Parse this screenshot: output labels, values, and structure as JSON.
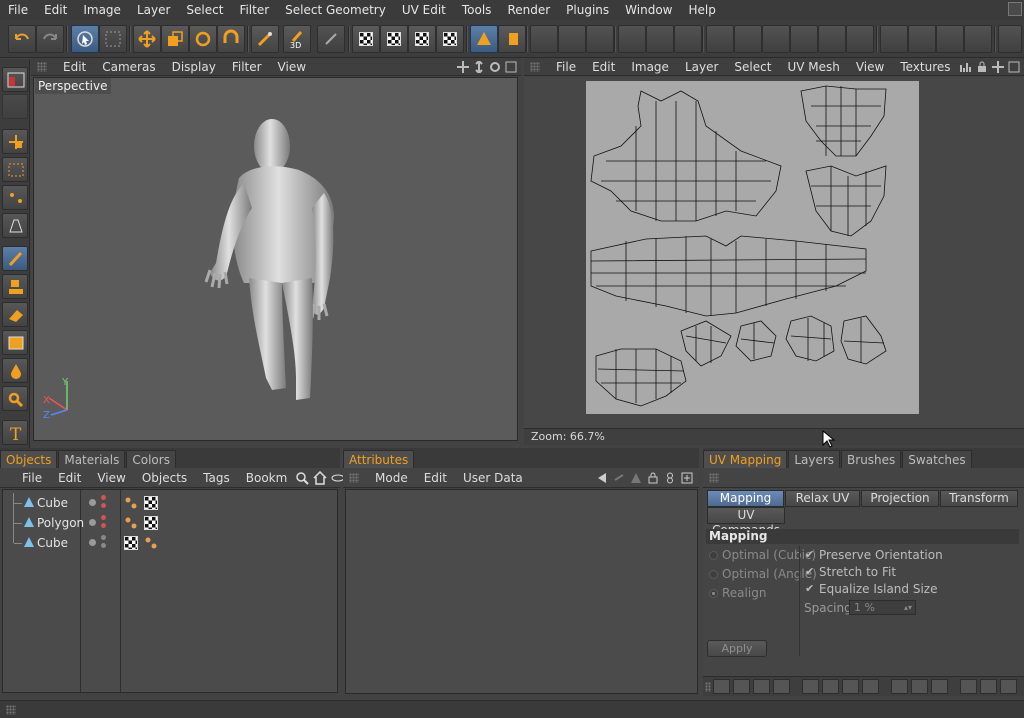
{
  "menubar": {
    "items": [
      "File",
      "Edit",
      "Image",
      "Layer",
      "Select",
      "Filter",
      "Select Geometry",
      "UV Edit",
      "Tools",
      "Render",
      "Plugins",
      "Window",
      "Help"
    ]
  },
  "toolbar": {
    "icons": [
      "undo-icon",
      "redo-icon",
      "live-selection-icon",
      "selection-lock-icon",
      "move-icon",
      "scale-icon",
      "rotate-icon",
      "magnet-icon",
      "paint-brush-icon",
      "3d-paint-icon",
      "texture-icon"
    ]
  },
  "viewport": {
    "menu": [
      "Edit",
      "Cameras",
      "Display",
      "Filter",
      "View"
    ],
    "label": "Perspective",
    "axes": {
      "x": "X",
      "y": "Y",
      "z": "Z"
    }
  },
  "uv_editor": {
    "menu": [
      "File",
      "Edit",
      "Image",
      "Layer",
      "Select",
      "UV Mesh",
      "View",
      "Textures"
    ],
    "status": "Zoom: 66.7%"
  },
  "objects_panel": {
    "tabs": [
      "Objects",
      "Materials",
      "Colors"
    ],
    "menu": [
      "File",
      "Edit",
      "View",
      "Objects",
      "Tags",
      "Bookm"
    ],
    "rows": [
      {
        "name": "Cube"
      },
      {
        "name": "Polygon"
      },
      {
        "name": "Cube"
      }
    ]
  },
  "attributes_panel": {
    "tabs": [
      "Attributes"
    ],
    "menu": [
      "Mode",
      "Edit",
      "User Data"
    ]
  },
  "uv_mapping_panel": {
    "tabs": [
      "UV Mapping",
      "Layers",
      "Brushes",
      "Swatches"
    ],
    "subtabs": [
      "Mapping",
      "Relax UV",
      "Projection",
      "Transform",
      "UV Commands"
    ],
    "section_title": "Mapping",
    "radio_options": [
      "Optimal (Cubic)",
      "Optimal (Angle)",
      "Realign"
    ],
    "checkboxes": [
      "Preserve Orientation",
      "Stretch to Fit",
      "Equalize Island Size"
    ],
    "spacing_label": "Spacing",
    "spacing_value": "1 %",
    "apply_label": "Apply"
  },
  "colors": {
    "active_tab": "#f0a020",
    "accent_blue": "#5c7fa8",
    "uv_canvas": "#a9a9a9"
  }
}
